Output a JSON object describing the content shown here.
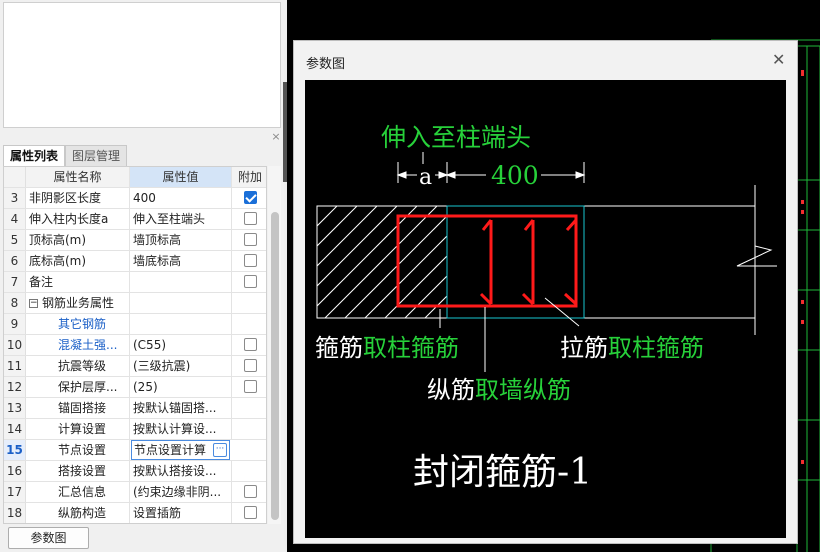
{
  "panel": {
    "tabs": [
      {
        "label": "属性列表",
        "active": true
      },
      {
        "label": "图层管理",
        "active": false
      }
    ],
    "header": {
      "num": "",
      "name": "属性名称",
      "value": "属性值",
      "add": "附加"
    },
    "rows": [
      {
        "num": "3",
        "name": "非阴影区长度",
        "value": "400",
        "check": "checked"
      },
      {
        "num": "4",
        "name": "伸入柱内长度a",
        "value": "伸入至柱端头",
        "check": "unchecked"
      },
      {
        "num": "5",
        "name": "顶标高(m)",
        "value": "墙顶标高",
        "check": "unchecked"
      },
      {
        "num": "6",
        "name": "底标高(m)",
        "value": "墙底标高",
        "check": "unchecked"
      },
      {
        "num": "7",
        "name": "备注",
        "value": "",
        "check": "unchecked"
      },
      {
        "num": "8",
        "name": "钢筋业务属性",
        "value": "",
        "check": "none",
        "group": true
      },
      {
        "num": "9",
        "name": "其它钢筋",
        "value": "",
        "check": "none",
        "link": true
      },
      {
        "num": "10",
        "name": "混凝土强...",
        "value": "(C55)",
        "check": "unchecked",
        "link": true
      },
      {
        "num": "11",
        "name": "抗震等级",
        "value": "(三级抗震)",
        "check": "unchecked"
      },
      {
        "num": "12",
        "name": "保护层厚...",
        "value": "(25)",
        "check": "unchecked"
      },
      {
        "num": "13",
        "name": "锚固搭接",
        "value": "按默认锚固搭...",
        "check": "none"
      },
      {
        "num": "14",
        "name": "计算设置",
        "value": "按默认计算设...",
        "check": "none"
      },
      {
        "num": "15",
        "name": "节点设置",
        "value": "节点设置计算",
        "check": "none",
        "selected": true
      },
      {
        "num": "16",
        "name": "搭接设置",
        "value": "按默认搭接设...",
        "check": "none"
      },
      {
        "num": "17",
        "name": "汇总信息",
        "value": "(约束边缘非阴...",
        "check": "unchecked"
      },
      {
        "num": "18",
        "name": "纵筋构造",
        "value": "设置插筋",
        "check": "unchecked"
      }
    ],
    "ellipsis_label": "···",
    "close_label": "×",
    "param_button": "参数图"
  },
  "dialog": {
    "title": "参数图",
    "close_label": "✕",
    "drawing": {
      "top_label": "伸入至柱端头",
      "dim_a": "a",
      "dim_400": "400",
      "stirrup_white": "箍筋",
      "stirrup_green": "取柱箍筋",
      "tie_white": "拉筋",
      "tie_green": "取柱箍筋",
      "long_white": "纵筋",
      "long_green": "取墙纵筋",
      "caption": "封闭箍筋-1"
    }
  },
  "colors": {
    "cad_background": "#000000",
    "rebar_red": "#ff1a1a",
    "annotation_green": "#27d13a",
    "selection_blue": "#1a5fc7",
    "cad_green_lines": "#1fb83a"
  }
}
